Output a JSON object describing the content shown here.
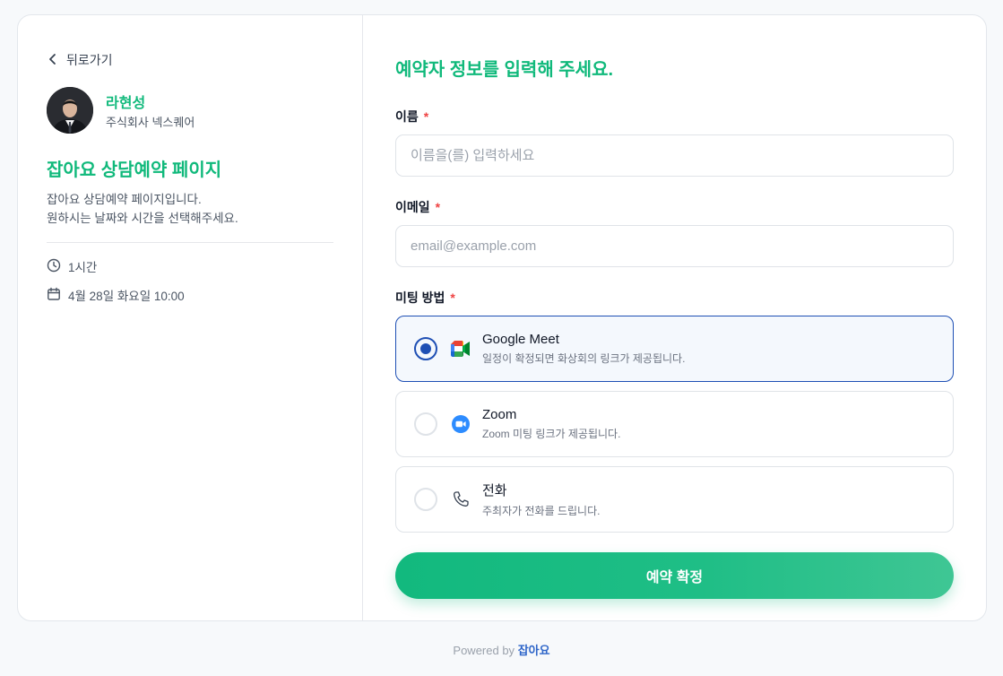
{
  "left": {
    "back_label": "뒤로가기",
    "host_name": "라현성",
    "host_company": "주식회사 넥스퀘어",
    "page_title": "잡아요 상담예약 페이지",
    "description_line1": "잡아요 상담예약 페이지입니다.",
    "description_line2": "원하시는 날짜와 시간을 선택해주세요.",
    "duration": "1시간",
    "datetime": "4월 28일 화요일 10:00"
  },
  "form": {
    "title": "예약자 정보를 입력해 주세요.",
    "name_label": "이름",
    "name_placeholder": "이름을(를) 입력하세요",
    "name_value": "",
    "email_label": "이메일",
    "email_placeholder": "email@example.com",
    "email_value": "",
    "meeting_label": "미팅 방법",
    "required_mark": "*",
    "options": [
      {
        "title": "Google Meet",
        "desc": "일정이 확정되면 화상회의 링크가 제공됩니다.",
        "icon": "google-meet-icon",
        "selected": true
      },
      {
        "title": "Zoom",
        "desc": "Zoom 미팅 링크가 제공됩니다.",
        "icon": "zoom-icon",
        "selected": false
      },
      {
        "title": "전화",
        "desc": "주최자가 전화를 드립니다.",
        "icon": "phone-icon",
        "selected": false
      }
    ],
    "submit_label": "예약 확정"
  },
  "footer": {
    "powered_by": "Powered by",
    "brand": "잡아요"
  },
  "colors": {
    "accent": "#10b97b",
    "selected_border": "#1e4fb4",
    "required": "#ef4444",
    "footer_brand": "#2f66c9"
  }
}
